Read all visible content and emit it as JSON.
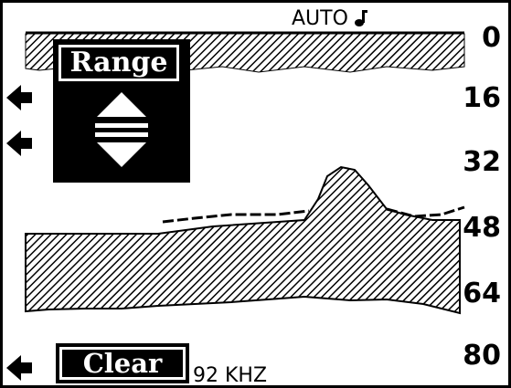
{
  "display": {
    "mode_label": "AUTO",
    "frequency_label": "92 KHZ",
    "depth_scale": [
      "0",
      "16",
      "32",
      "48",
      "64",
      "80"
    ]
  },
  "range_menu": {
    "title": "Range",
    "up_icon": "triangle-up-icon",
    "down_icon": "triangle-down-icon"
  },
  "clear_button": {
    "label": "Clear"
  },
  "side_arrows": {
    "icon": "left-arrow-icon"
  },
  "colors": {
    "ink": "#000000",
    "paper": "#ffffff"
  }
}
